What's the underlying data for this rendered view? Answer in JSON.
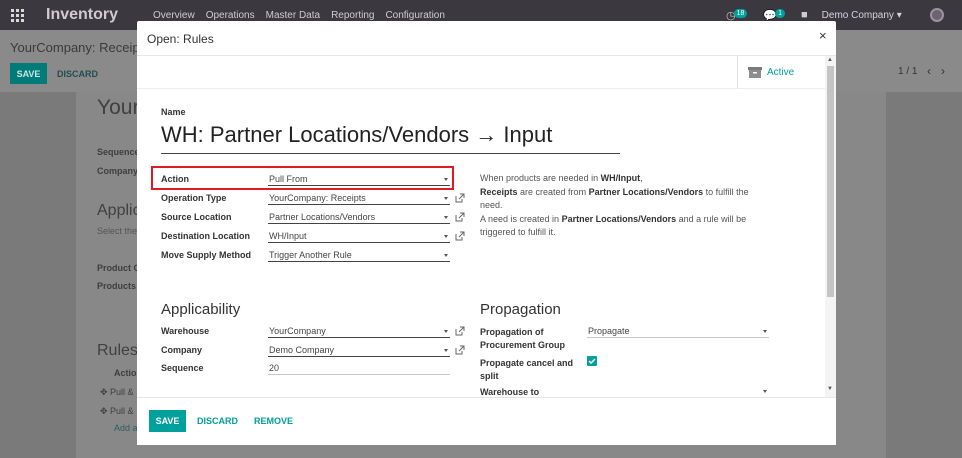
{
  "topbar": {
    "brand": "Inventory",
    "menu": [
      "Overview",
      "Operations",
      "Master Data",
      "Reporting",
      "Configuration"
    ],
    "activity_count": "18",
    "message_count": "1",
    "company": "Demo Company"
  },
  "control_panel": {
    "breadcrumb": "YourCompany: Receipts",
    "save": "SAVE",
    "discard": "DISCARD",
    "pager": "1 / 1"
  },
  "background_form": {
    "title": "Your",
    "fields": [
      "Sequence",
      "Company"
    ],
    "section_applicability": "Applic",
    "applicability_hint": "Select the",
    "product_fields": [
      "Product C",
      "Products"
    ],
    "rules_title": "Rules",
    "rules_col_action": "Action",
    "rules_rows": [
      "Pull &",
      "Pull &"
    ],
    "add_line": "Add a"
  },
  "modal": {
    "title": "Open: Rules",
    "close": "×",
    "active_label": "Active",
    "name_label": "Name",
    "name_value": "WH: Partner Locations/Vendors → Input",
    "fields": {
      "action": {
        "label": "Action",
        "value": "Pull From"
      },
      "operation_type": {
        "label": "Operation Type",
        "value": "YourCompany: Receipts"
      },
      "source_location": {
        "label": "Source Location",
        "value": "Partner Locations/Vendors"
      },
      "destination_location": {
        "label": "Destination Location",
        "value": "WH/Input"
      },
      "move_supply_method": {
        "label": "Move Supply Method",
        "value": "Trigger Another Rule"
      }
    },
    "help": {
      "l1a": "When products are needed in ",
      "l1b": "WH/Input",
      "l1c": ",",
      "l2a": "Receipts",
      "l2b": " are created from ",
      "l2c": "Partner Locations/Vendors",
      "l2d": " to fulfill the",
      "l3": "need.",
      "l4a": "A need is created in ",
      "l4b": "Partner Locations/Vendors",
      "l4c": " and a rule will be",
      "l5": "triggered to fulfill it."
    },
    "applicability": {
      "title": "Applicability",
      "warehouse": {
        "label": "Warehouse",
        "value": "YourCompany"
      },
      "company": {
        "label": "Company",
        "value": "Demo Company"
      },
      "sequence": {
        "label": "Sequence",
        "value": "20"
      }
    },
    "propagation": {
      "title": "Propagation",
      "group_label_1": "Propagation of",
      "group_label_2": "Procurement Group",
      "group_value": "Propagate",
      "cancel_label_1": "Propagate cancel and",
      "cancel_label_2": "split",
      "cancel_checked": true,
      "warehouse_to_label": "Warehouse to"
    },
    "footer": {
      "save": "SAVE",
      "discard": "DISCARD",
      "remove": "REMOVE"
    }
  }
}
